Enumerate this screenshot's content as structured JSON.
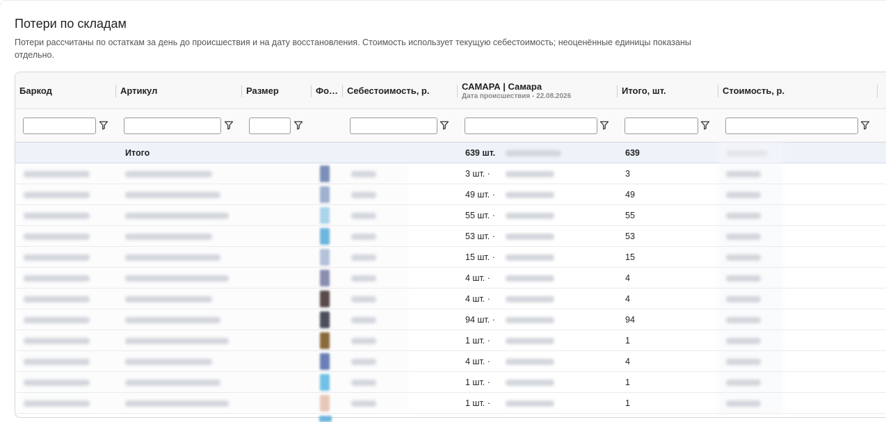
{
  "page": {
    "title": "Потери по складам",
    "description": "Потери рассчитаны по остаткам за день до происшествия и на дату восстановления. Стоимость использует текущую себестоимость; неоценённые единицы показаны отдельно."
  },
  "columns": {
    "barcode": "Баркод",
    "article": "Артикул",
    "size": "Размер",
    "photo": "Фо…",
    "cost": "Себестоимость, р.",
    "warehouse": "САМАРА | Самара",
    "warehouse_sub": "Дата происшествия - 22.08.2026",
    "total_qty": "Итого, шт.",
    "total_cost": "Стоимость, р."
  },
  "filters": {
    "barcode": "",
    "article": "",
    "size": "",
    "cost": "",
    "warehouse": "",
    "total_qty": "",
    "total_cost": ""
  },
  "icons": {
    "filter": "filter-icon"
  },
  "colors": {
    "total_row_bg": "#eef3fa",
    "header_bg": "#f8f8f8",
    "border": "#d6d6d6"
  },
  "totals": {
    "label": "Итого",
    "warehouse_qty": "639 шт.",
    "total_qty": "639"
  },
  "rows": [
    {
      "warehouse_qty": "3 шт. ·",
      "total_qty": "3",
      "thumb": "#7c8fb8"
    },
    {
      "warehouse_qty": "49 шт. ·",
      "total_qty": "49",
      "thumb": "#9fb1d0"
    },
    {
      "warehouse_qty": "55 шт. ·",
      "total_qty": "55",
      "thumb": "#a9d4ea"
    },
    {
      "warehouse_qty": "53 шт. ·",
      "total_qty": "53",
      "thumb": "#6fb6de"
    },
    {
      "warehouse_qty": "15 шт. ·",
      "total_qty": "15",
      "thumb": "#b4c2d9"
    },
    {
      "warehouse_qty": "4 шт. ·",
      "total_qty": "4",
      "thumb": "#8a8fb0"
    },
    {
      "warehouse_qty": "4 шт. ·",
      "total_qty": "4",
      "thumb": "#5a4a4a"
    },
    {
      "warehouse_qty": "94 шт. ·",
      "total_qty": "94",
      "thumb": "#4a4f5a"
    },
    {
      "warehouse_qty": "1 шт. ·",
      "total_qty": "1",
      "thumb": "#8a6a3a"
    },
    {
      "warehouse_qty": "4 шт. ·",
      "total_qty": "4",
      "thumb": "#6a7fb5"
    },
    {
      "warehouse_qty": "1 шт. ·",
      "total_qty": "1",
      "thumb": "#72c0e6"
    },
    {
      "warehouse_qty": "1 шт. ·",
      "total_qty": "1",
      "thumb": "#e8c7b8"
    }
  ]
}
